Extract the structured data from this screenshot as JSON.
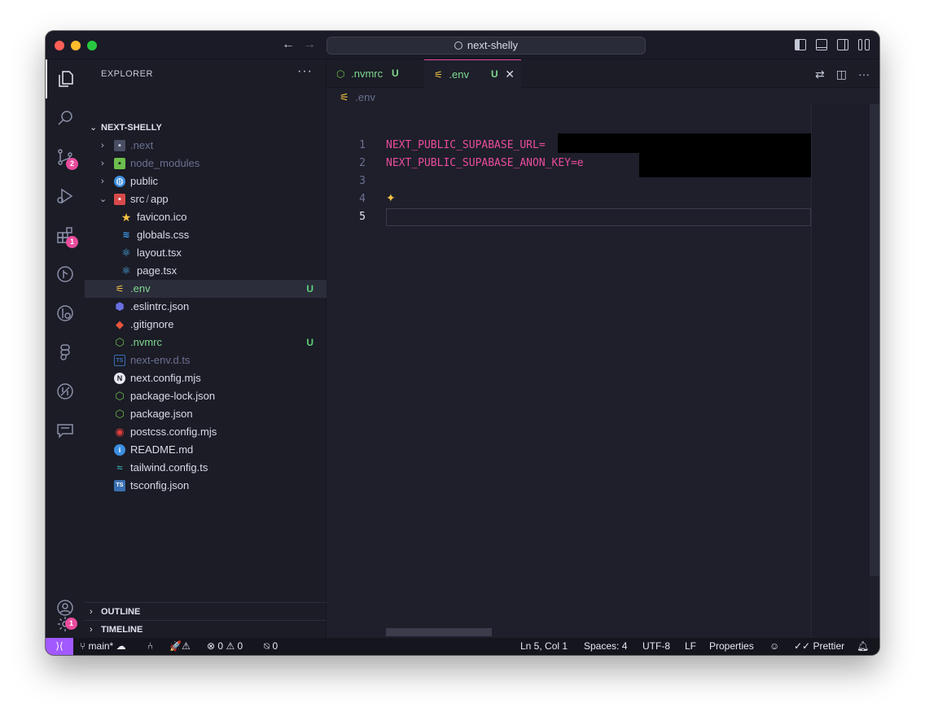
{
  "window": {
    "title": "next-shelly"
  },
  "activity_badges": {
    "source_control": "2",
    "extensions": "1",
    "settings": "1"
  },
  "sidebar": {
    "title": "EXPLORER",
    "more": "···",
    "project": "NEXT-SHELLY",
    "items": [
      {
        "name": ".next",
        "icon": "folder-next-icon"
      },
      {
        "name": "node_modules",
        "icon": "folder-node-icon"
      },
      {
        "name": "public",
        "icon": "folder-public-icon"
      },
      {
        "name": "src",
        "sep": "/",
        "name2": "app",
        "icon": "folder-src-icon"
      },
      {
        "name": "favicon.ico",
        "icon": "star-icon"
      },
      {
        "name": "globals.css",
        "icon": "css-icon"
      },
      {
        "name": "layout.tsx",
        "icon": "react-icon"
      },
      {
        "name": "page.tsx",
        "icon": "react-icon"
      },
      {
        "name": ".env",
        "icon": "env-icon",
        "status": "U"
      },
      {
        "name": ".eslintrc.json",
        "icon": "eslint-icon"
      },
      {
        "name": ".gitignore",
        "icon": "git-icon"
      },
      {
        "name": ".nvmrc",
        "icon": "node-icon",
        "status": "U"
      },
      {
        "name": "next-env.d.ts",
        "icon": "ts-icon"
      },
      {
        "name": "next.config.mjs",
        "icon": "next-icon"
      },
      {
        "name": "package-lock.json",
        "icon": "node-icon"
      },
      {
        "name": "package.json",
        "icon": "node-icon"
      },
      {
        "name": "postcss.config.mjs",
        "icon": "postcss-icon"
      },
      {
        "name": "README.md",
        "icon": "info-icon"
      },
      {
        "name": "tailwind.config.ts",
        "icon": "tailwind-icon"
      },
      {
        "name": "tsconfig.json",
        "icon": "tsconfig-icon"
      }
    ],
    "outline": "OUTLINE",
    "timeline": "TIMELINE"
  },
  "tabs": [
    {
      "label": ".nvmrc",
      "status": "U"
    },
    {
      "label": ".env",
      "status": "U",
      "close": "✕"
    }
  ],
  "editor": {
    "breadcrumb": ".env",
    "line_numbers": [
      "1",
      "2",
      "3",
      "4",
      "5"
    ],
    "lines": [
      "NEXT_PUBLIC_SUPABASE_URL=",
      "NEXT_PUBLIC_SUPABASE_ANON_KEY=e",
      "",
      "",
      ""
    ]
  },
  "statusbar": {
    "branch": "main*",
    "errors": "0",
    "warnings": "0",
    "ports": "0",
    "position": "Ln 5, Col 1",
    "spaces": "Spaces: 4",
    "encoding": "UTF-8",
    "eol": "LF",
    "language": "Properties",
    "formatter": "Prettier"
  },
  "colors": {
    "accent": "#e94c9c",
    "untracked": "#5fd27a",
    "remote": "#a259ff"
  }
}
